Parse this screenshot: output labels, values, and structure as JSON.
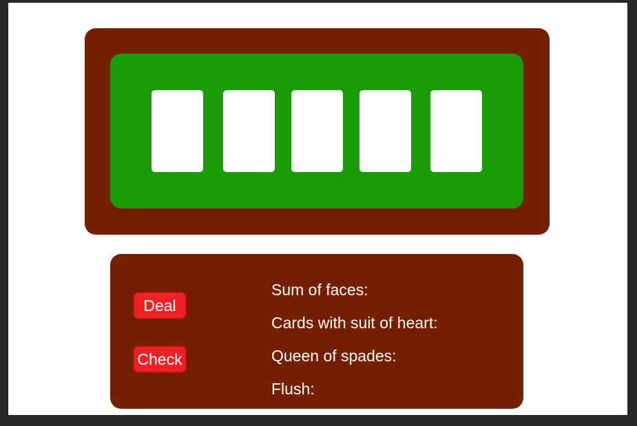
{
  "colors": {
    "frame": "#731f00",
    "felt": "#1a9c07",
    "card": "#ffffff",
    "button": "#ee2127",
    "text": "#ffffff"
  },
  "cards": [
    {
      "face": ""
    },
    {
      "face": ""
    },
    {
      "face": ""
    },
    {
      "face": ""
    },
    {
      "face": ""
    }
  ],
  "controls": {
    "deal_label": "Deal",
    "check_label": "Check"
  },
  "stats": {
    "sum_of_faces": "Sum of faces:",
    "cards_with_heart": "Cards with suit of heart:",
    "queen_of_spades": "Queen of spades:",
    "flush": "Flush:"
  }
}
